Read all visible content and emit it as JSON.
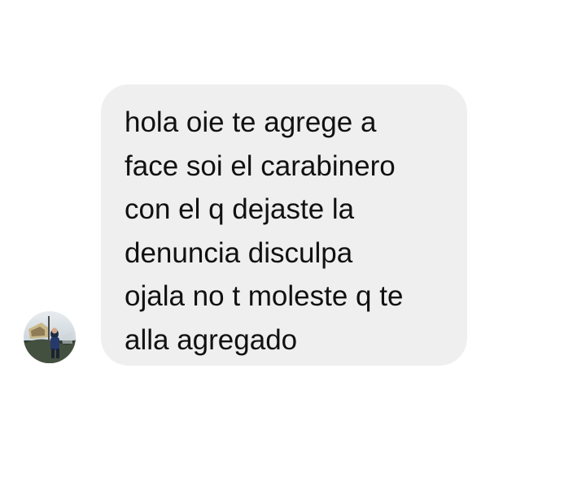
{
  "message": {
    "lines": [
      "hola oie te agrege a",
      "face soi el carabinero",
      "con el q dejaste la",
      "denuncia disculpa",
      "ojala no t moleste q te",
      "alla agregado"
    ]
  },
  "colors": {
    "background": "#ffffff",
    "bubble": "#efefef",
    "text": "#111111"
  },
  "icons": {
    "avatar": "profile-photo"
  }
}
